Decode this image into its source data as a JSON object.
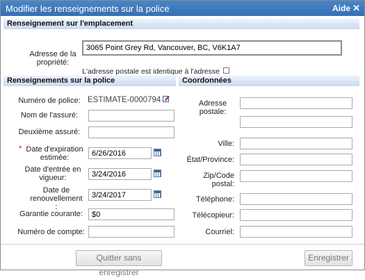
{
  "dialog": {
    "title": "Modifier les renseignements sur la police",
    "help": "Aide",
    "close_glyph": "✕"
  },
  "location": {
    "header": "Renseignement sur l'emplacement",
    "address_label": "Adresse de la propriété:",
    "address_value": "3065 Point Grey Rd, Vancouver, BC, V6K1A7",
    "same_address_label": "L'adresse postale est identique à l'adresse du bien:",
    "same_address_checked": false
  },
  "policy": {
    "header": "Renseignements sur la police",
    "policy_number_label": "Numéro de police:",
    "policy_number_value": "ESTIMATE-0000794",
    "insured_label": "Nom de l'assuré:",
    "insured_value": "",
    "second_insured_label": "Deuxième assuré:",
    "second_insured_value": "",
    "required_marker": "*",
    "expiry_label": "Date d'expiration estimée:",
    "expiry_value": "6/26/2016",
    "effective_label": "Date d'entrée en vigueur:",
    "effective_value": "3/24/2016",
    "renewal_label": "Date de renouvellement :",
    "renewal_value": "3/24/2017",
    "coverage_label": "Garantie courante:",
    "coverage_value": "$0",
    "account_label": "Numéro de compte:",
    "account_value": ""
  },
  "contact": {
    "header": "Coordonnées",
    "postal_label": "Adresse postale:",
    "postal_line1": "",
    "postal_line2": "",
    "city_label": "Ville:",
    "city_value": "",
    "state_label": "État/Province:",
    "state_value": "",
    "zip_label": "Zip/Code postal:",
    "zip_value": "",
    "phone_label": "Téléphone:",
    "phone_value": "",
    "fax_label": "Télécopieur:",
    "fax_value": "",
    "email_label": "Courriel:",
    "email_value": ""
  },
  "footer": {
    "quit_label": "Quitter sans enregistrer",
    "save_label": "Enregistrer"
  }
}
